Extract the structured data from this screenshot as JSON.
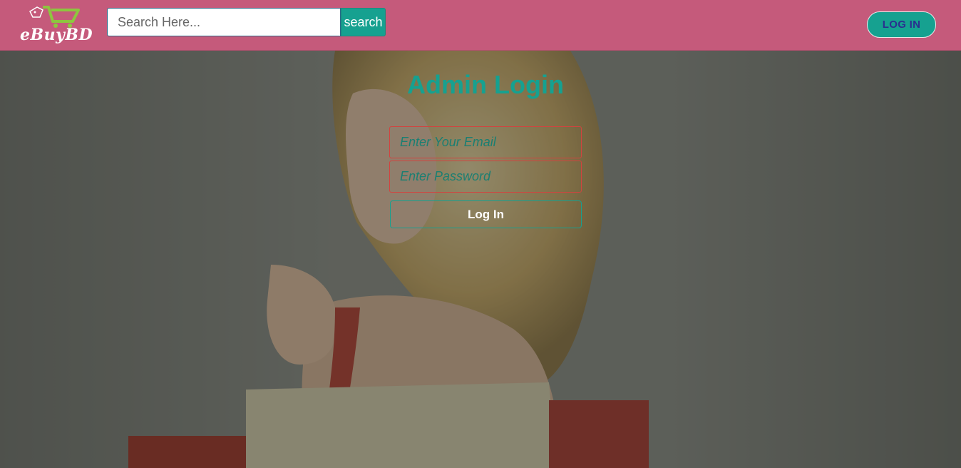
{
  "header": {
    "logo_text": "eBuyBD",
    "search": {
      "placeholder": "Search Here...",
      "value": "",
      "button_label": "search"
    },
    "login_label": "LOG IN"
  },
  "login": {
    "title": "Admin Login",
    "email_placeholder": "Enter Your Email",
    "password_placeholder": "Enter Password",
    "submit_label": "Log In"
  },
  "colors": {
    "header": "#c55a7b",
    "accent": "#16a190",
    "field_border": "#d2433f"
  },
  "icons": {
    "logo": "shopping-cart-icon"
  }
}
